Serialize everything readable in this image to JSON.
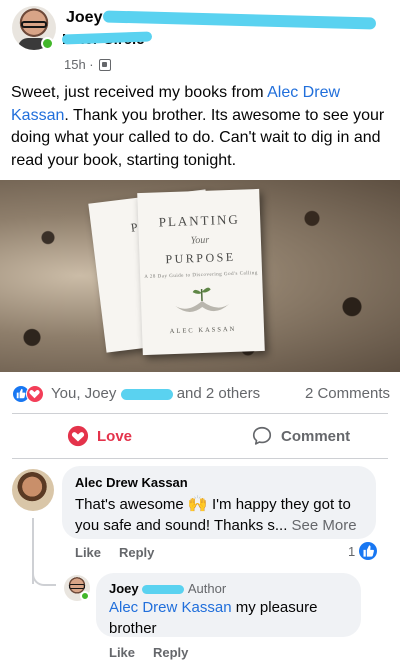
{
  "post": {
    "author_name": "Joey",
    "group_name": "Inner Circle",
    "timestamp": "15h ·",
    "audience_icon": "group-icon",
    "text_before": "Sweet, just received my books from ",
    "mention": "Alec Drew Kassan",
    "text_after": ". Thank you brother. Its awesome to see your doing what your called to do. Can't wait to dig in and read your book, starting tonight."
  },
  "photo": {
    "book_title_line1": "PLANTING",
    "book_title_line2": "Your",
    "book_title_line3": "PURPOSE",
    "book_subtitle": "A 28 Day Guide to Discovering God's Calling",
    "book_author": "ALEC KASSAN",
    "back_book_line1": "PLAN",
    "back_book_line2": "PU"
  },
  "reactions": {
    "icons": [
      "like-icon",
      "love-icon"
    ],
    "summary_prefix": "You, Joey",
    "summary_suffix": "and 2 others",
    "comments_count": "2 Comments"
  },
  "actions": {
    "love_label": "Love",
    "comment_label": "Comment"
  },
  "comments": [
    {
      "author": "Alec Drew Kassan",
      "text_before": "That's awesome ",
      "emoji": "🙌",
      "text_after": " I'm happy they got to you safe and sound! Thanks s...",
      "see_more": " See More",
      "like_label": "Like",
      "reply_label": "Reply",
      "like_count": "1"
    },
    {
      "author": "Joey",
      "author_badge": "Author",
      "mention": "Alec Drew Kassan",
      "text_after": " my pleasure brother",
      "like_label": "Like",
      "reply_label": "Reply"
    }
  ],
  "colors": {
    "accent_blue": "#1877f2",
    "link_blue": "#216fdb",
    "love_red": "#e4334b",
    "online_green": "#42b72a",
    "secondary_text": "#65676b"
  }
}
